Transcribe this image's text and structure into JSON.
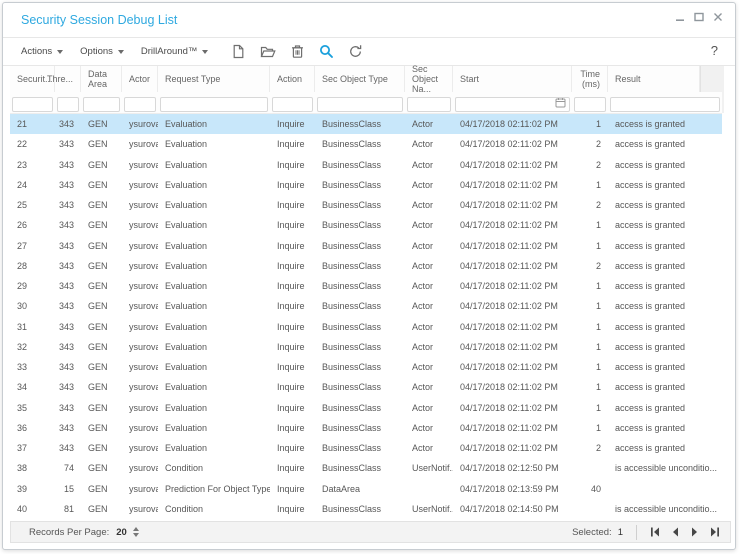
{
  "window": {
    "title": "Security Session Debug List"
  },
  "titlebar_icons": [
    "minimize-icon",
    "maximize-icon",
    "close-icon"
  ],
  "toolbar": {
    "menus": [
      {
        "label": "Actions"
      },
      {
        "label": "Options"
      },
      {
        "label": "DrillAround™"
      }
    ],
    "icons": [
      "new-document",
      "open-folder",
      "delete",
      "search",
      "refresh"
    ],
    "help_label": "?"
  },
  "table": {
    "columns": [
      {
        "key": "security",
        "label": "Securit..."
      },
      {
        "key": "thread",
        "label": "Thre..."
      },
      {
        "key": "data_area",
        "label": "Data\nArea"
      },
      {
        "key": "actor",
        "label": "Actor"
      },
      {
        "key": "request_type",
        "label": "Request Type"
      },
      {
        "key": "action",
        "label": "Action"
      },
      {
        "key": "sec_object_type",
        "label": "Sec Object Type"
      },
      {
        "key": "sec_object_name",
        "label": "Sec\nObject Na..."
      },
      {
        "key": "start",
        "label": "Start"
      },
      {
        "key": "time_ms",
        "label": "Time\n(ms)"
      },
      {
        "key": "result",
        "label": "Result"
      }
    ],
    "selected_index": 0,
    "rows": [
      [
        "21",
        "343",
        "GEN",
        "ysurova",
        "Evaluation",
        "Inquire",
        "BusinessClass",
        "Actor",
        "04/17/2018 02:11:02 PM",
        "1",
        "access is granted"
      ],
      [
        "22",
        "343",
        "GEN",
        "ysurova",
        "Evaluation",
        "Inquire",
        "BusinessClass",
        "Actor",
        "04/17/2018 02:11:02 PM",
        "2",
        "access is granted"
      ],
      [
        "23",
        "343",
        "GEN",
        "ysurova",
        "Evaluation",
        "Inquire",
        "BusinessClass",
        "Actor",
        "04/17/2018 02:11:02 PM",
        "2",
        "access is granted"
      ],
      [
        "24",
        "343",
        "GEN",
        "ysurova",
        "Evaluation",
        "Inquire",
        "BusinessClass",
        "Actor",
        "04/17/2018 02:11:02 PM",
        "1",
        "access is granted"
      ],
      [
        "25",
        "343",
        "GEN",
        "ysurova",
        "Evaluation",
        "Inquire",
        "BusinessClass",
        "Actor",
        "04/17/2018 02:11:02 PM",
        "2",
        "access is granted"
      ],
      [
        "26",
        "343",
        "GEN",
        "ysurova",
        "Evaluation",
        "Inquire",
        "BusinessClass",
        "Actor",
        "04/17/2018 02:11:02 PM",
        "1",
        "access is granted"
      ],
      [
        "27",
        "343",
        "GEN",
        "ysurova",
        "Evaluation",
        "Inquire",
        "BusinessClass",
        "Actor",
        "04/17/2018 02:11:02 PM",
        "1",
        "access is granted"
      ],
      [
        "28",
        "343",
        "GEN",
        "ysurova",
        "Evaluation",
        "Inquire",
        "BusinessClass",
        "Actor",
        "04/17/2018 02:11:02 PM",
        "2",
        "access is granted"
      ],
      [
        "29",
        "343",
        "GEN",
        "ysurova",
        "Evaluation",
        "Inquire",
        "BusinessClass",
        "Actor",
        "04/17/2018 02:11:02 PM",
        "1",
        "access is granted"
      ],
      [
        "30",
        "343",
        "GEN",
        "ysurova",
        "Evaluation",
        "Inquire",
        "BusinessClass",
        "Actor",
        "04/17/2018 02:11:02 PM",
        "1",
        "access is granted"
      ],
      [
        "31",
        "343",
        "GEN",
        "ysurova",
        "Evaluation",
        "Inquire",
        "BusinessClass",
        "Actor",
        "04/17/2018 02:11:02 PM",
        "1",
        "access is granted"
      ],
      [
        "32",
        "343",
        "GEN",
        "ysurova",
        "Evaluation",
        "Inquire",
        "BusinessClass",
        "Actor",
        "04/17/2018 02:11:02 PM",
        "1",
        "access is granted"
      ],
      [
        "33",
        "343",
        "GEN",
        "ysurova",
        "Evaluation",
        "Inquire",
        "BusinessClass",
        "Actor",
        "04/17/2018 02:11:02 PM",
        "1",
        "access is granted"
      ],
      [
        "34",
        "343",
        "GEN",
        "ysurova",
        "Evaluation",
        "Inquire",
        "BusinessClass",
        "Actor",
        "04/17/2018 02:11:02 PM",
        "1",
        "access is granted"
      ],
      [
        "35",
        "343",
        "GEN",
        "ysurova",
        "Evaluation",
        "Inquire",
        "BusinessClass",
        "Actor",
        "04/17/2018 02:11:02 PM",
        "1",
        "access is granted"
      ],
      [
        "36",
        "343",
        "GEN",
        "ysurova",
        "Evaluation",
        "Inquire",
        "BusinessClass",
        "Actor",
        "04/17/2018 02:11:02 PM",
        "1",
        "access is granted"
      ],
      [
        "37",
        "343",
        "GEN",
        "ysurova",
        "Evaluation",
        "Inquire",
        "BusinessClass",
        "Actor",
        "04/17/2018 02:11:02 PM",
        "2",
        "access is granted"
      ],
      [
        "38",
        "74",
        "GEN",
        "ysurova",
        "Condition",
        "Inquire",
        "BusinessClass",
        "UserNotif...",
        "04/17/2018 02:12:50 PM",
        "",
        "is accessible unconditio..."
      ],
      [
        "39",
        "15",
        "GEN",
        "ysurova",
        "Prediction For Object Type",
        "Inquire",
        "DataArea",
        "",
        "04/17/2018 02:13:59 PM",
        "40",
        ""
      ],
      [
        "40",
        "81",
        "GEN",
        "ysurova",
        "Condition",
        "Inquire",
        "BusinessClass",
        "UserNotif...",
        "04/17/2018 02:14:50 PM",
        "",
        "is accessible unconditio..."
      ]
    ]
  },
  "footer": {
    "records_per_page_label": "Records Per Page:",
    "records_per_page_value": "20",
    "selected_label": "Selected:",
    "selected_value": "1",
    "pager_icons": [
      "first-page-icon",
      "previous-page-icon",
      "next-page-icon",
      "last-page-icon"
    ]
  },
  "colors": {
    "title_accent": "#2fa9e0",
    "search_icon_blue": "#1ba0dc",
    "selected_row": "#c8e7fa"
  }
}
